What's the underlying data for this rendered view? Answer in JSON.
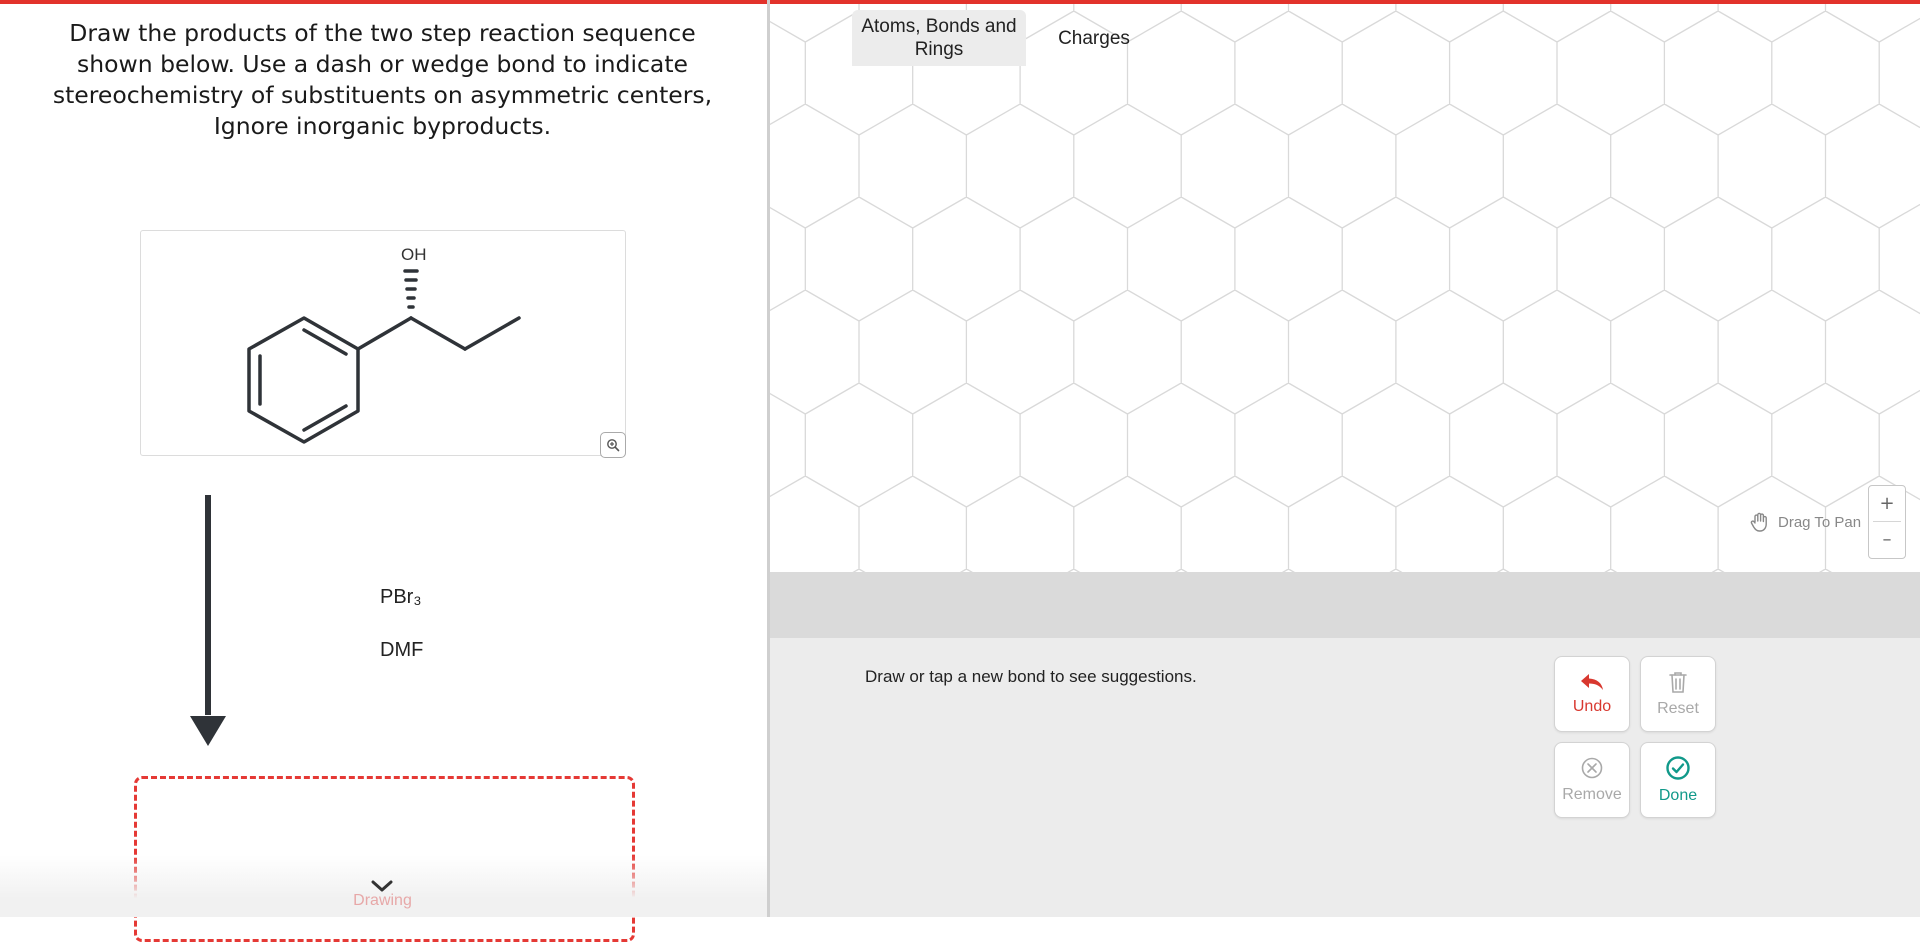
{
  "question": {
    "text": "Draw the products of the two step reaction sequence shown below. Use a dash or wedge bond to indicate stereochemistry of substituents on asymmetric centers, Ignore inorganic byproducts."
  },
  "molecule": {
    "oh_label": "OH"
  },
  "reagents": {
    "first": "PBr₃",
    "second": "DMF"
  },
  "drawing_drawer": {
    "label": "Drawing"
  },
  "canvas": {
    "drag_to_pan": "Drag To Pan",
    "zoom_in": "+",
    "zoom_out": "–"
  },
  "tabs": [
    {
      "label": "Atoms, Bonds and Rings",
      "active": true
    },
    {
      "label": "Charges",
      "active": false
    }
  ],
  "tool_panel": {
    "hint": "Draw or tap a new bond to see suggestions."
  },
  "actions": {
    "undo": "Undo",
    "reset": "Reset",
    "remove": "Remove",
    "done": "Done"
  },
  "colors": {
    "accent": "#e2322b",
    "undo": "#d8382f",
    "done": "#11998a",
    "dashed_border": "#e53935"
  }
}
